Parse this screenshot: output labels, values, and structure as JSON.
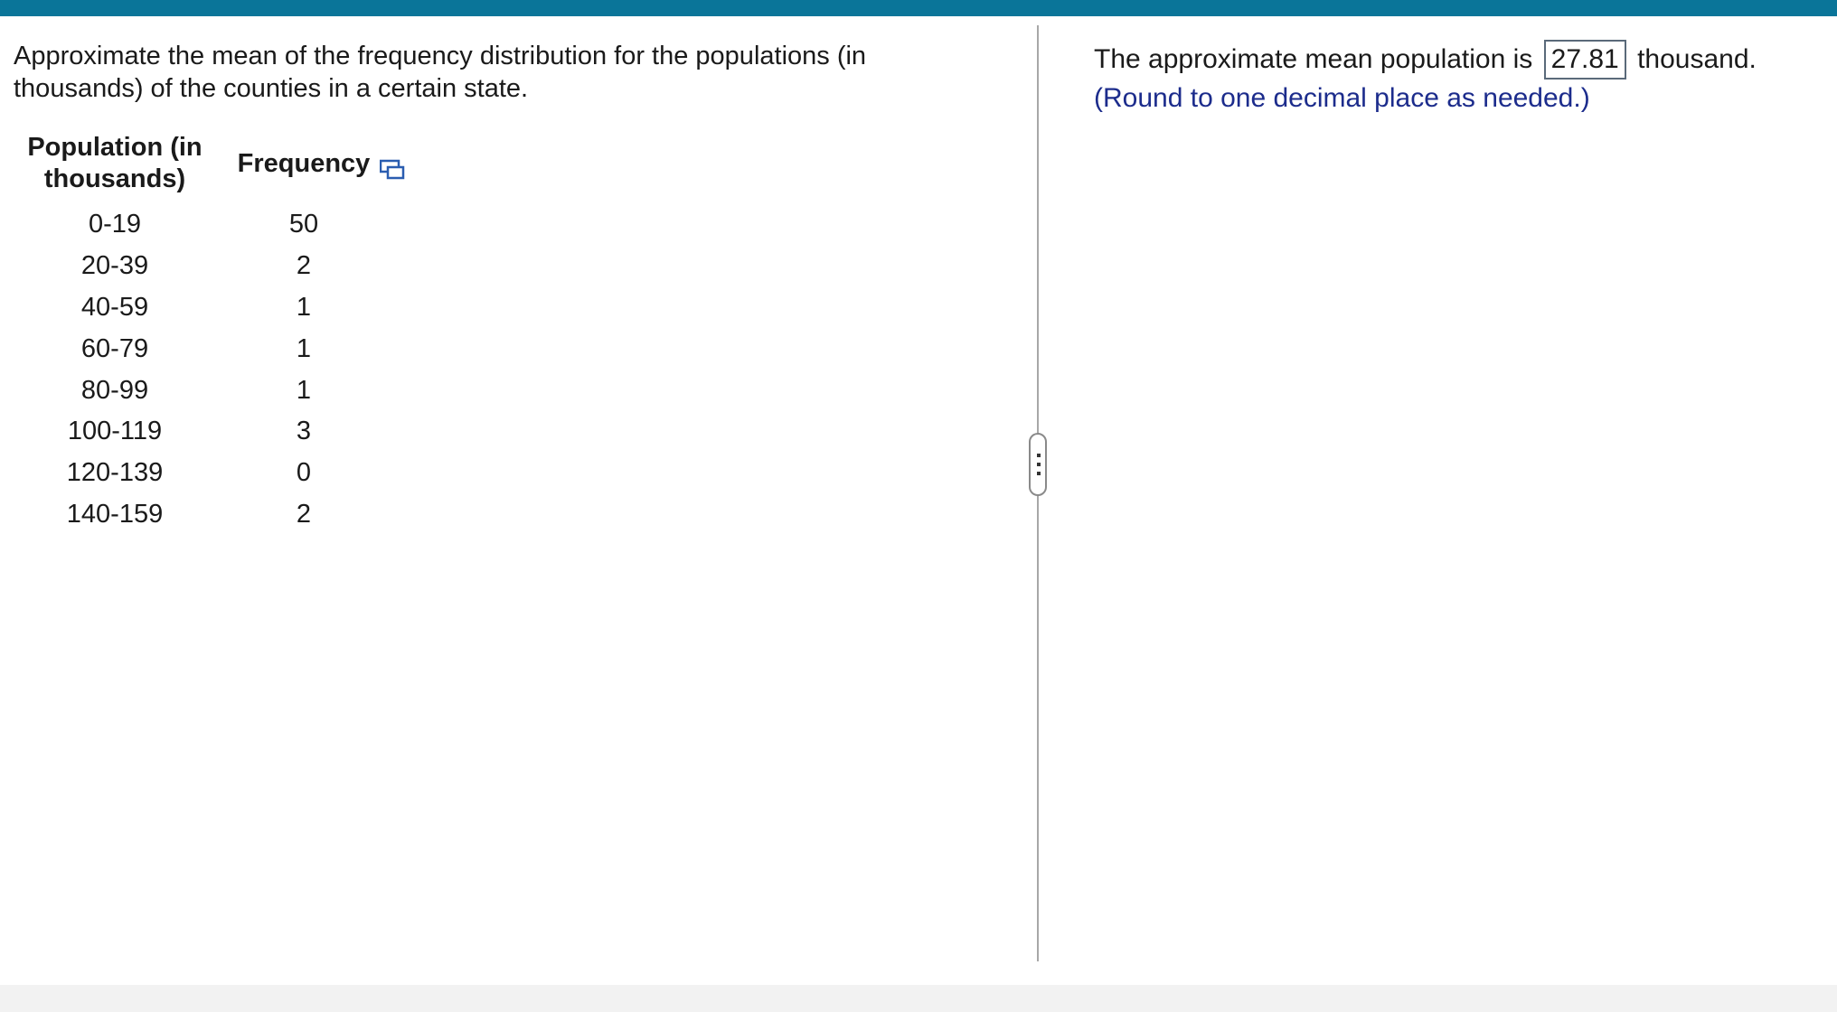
{
  "question": {
    "text": "Approximate the mean of the frequency distribution for the populations (in thousands) of the counties in a certain state."
  },
  "table": {
    "headers": {
      "population": "Population (in thousands)",
      "frequency": "Frequency"
    },
    "rows": [
      {
        "population": "0-19",
        "frequency": "50"
      },
      {
        "population": "20-39",
        "frequency": "2"
      },
      {
        "population": "40-59",
        "frequency": "1"
      },
      {
        "population": "60-79",
        "frequency": "1"
      },
      {
        "population": "80-99",
        "frequency": "1"
      },
      {
        "population": "100-119",
        "frequency": "3"
      },
      {
        "population": "120-139",
        "frequency": "0"
      },
      {
        "population": "140-159",
        "frequency": "2"
      }
    ],
    "copy_icon": "copy-icon"
  },
  "answer": {
    "prefix": "The approximate mean population is",
    "value": "27.81",
    "suffix": "thousand.",
    "hint": "(Round to one decimal place as needed.)"
  },
  "colors": {
    "top_bar": "#0a7599",
    "hint_text": "#1c2c8c",
    "icon": "#2a5db0"
  }
}
